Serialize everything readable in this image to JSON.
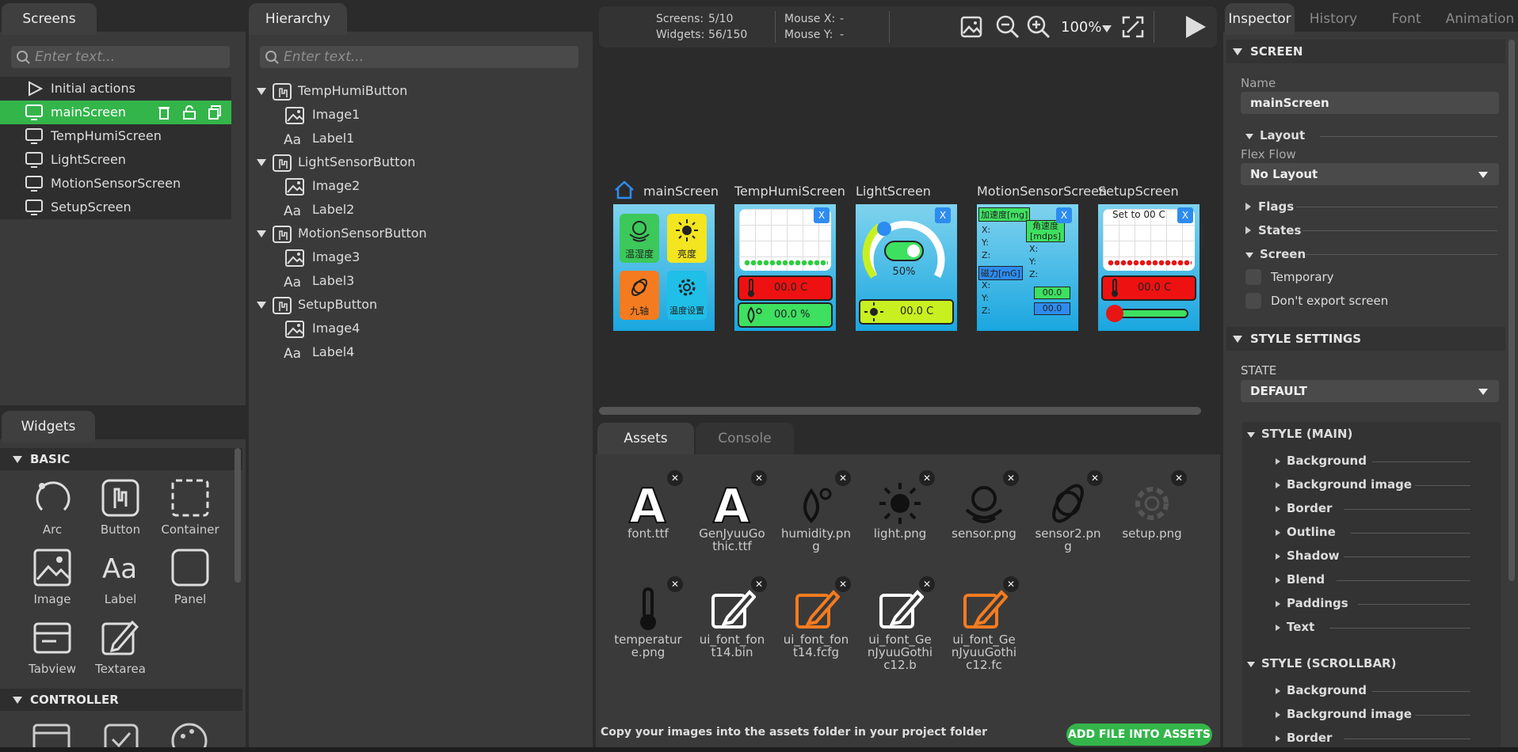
{
  "screens_panel": {
    "tab": "Screens",
    "search_placeholder": "Enter text...",
    "items": [
      {
        "label": "Initial actions"
      },
      {
        "label": "mainScreen"
      },
      {
        "label": "TempHumiScreen"
      },
      {
        "label": "LightScreen"
      },
      {
        "label": "MotionSensorScreen"
      },
      {
        "label": "SetupScreen"
      }
    ]
  },
  "hierarchy_panel": {
    "tab": "Hierarchy",
    "search_placeholder": "Enter text...",
    "items": [
      {
        "label": "TempHumiButton"
      },
      {
        "label": "Image1"
      },
      {
        "label": "Label1"
      },
      {
        "label": "LightSensorButton"
      },
      {
        "label": "Image2"
      },
      {
        "label": "Label2"
      },
      {
        "label": "MotionSensorButton"
      },
      {
        "label": "Image3"
      },
      {
        "label": "Label3"
      },
      {
        "label": "SetupButton"
      },
      {
        "label": "Image4"
      },
      {
        "label": "Label4"
      }
    ]
  },
  "widgets_panel": {
    "tab": "Widgets",
    "basic_header": "BASIC",
    "controller_header": "CONTROLLER",
    "basic": [
      {
        "label": "Arc",
        "icon": "arc-icon"
      },
      {
        "label": "Button",
        "icon": "button-icon"
      },
      {
        "label": "Container",
        "icon": "container-icon"
      },
      {
        "label": "Image",
        "icon": "image-icon"
      },
      {
        "label": "Label",
        "icon": "label-icon"
      },
      {
        "label": "Panel",
        "icon": "panel-icon"
      },
      {
        "label": "Tabview",
        "icon": "tabview-icon"
      },
      {
        "label": "Textarea",
        "icon": "textarea-icon"
      }
    ]
  },
  "toolbar": {
    "screens_label": "Screens:",
    "screens_value": "5/10",
    "widgets_label": "Widgets:",
    "widgets_value": "56/150",
    "mouse_x_label": "Mouse X:",
    "mouse_x_value": "-",
    "mouse_y_label": "Mouse Y:",
    "mouse_y_value": "-",
    "zoom": "100%"
  },
  "canvas": {
    "screens": [
      {
        "title": "mainScreen",
        "home": true
      },
      {
        "title": "TempHumiScreen"
      },
      {
        "title": "LightScreen"
      },
      {
        "title": "MotionSensorScreen"
      },
      {
        "title": "SetupScreen"
      }
    ],
    "main": {
      "btn1": "温湿度",
      "btn2": "亮度",
      "btn3": "九轴",
      "btn4": "温度设置"
    },
    "temphumi": {
      "temp": "00.0 C",
      "humi": "00.0 %"
    },
    "light": {
      "percent": "50%",
      "value": "00.0 C"
    },
    "motion": {
      "accel": "加速度[mg]",
      "gyro_line1": "角速度",
      "gyro_line2": "[mdps]",
      "mag": "磁力[mG]",
      "x": "X:",
      "y": "Y:",
      "z": "Z:",
      "val1": "00.0",
      "val2": "00.0"
    },
    "setup": {
      "title": "Set to 00 C",
      "temp": "00.0 C"
    },
    "close": "X"
  },
  "bottom_panel": {
    "tab_assets": "Assets",
    "tab_console": "Console",
    "assets": [
      {
        "name": "font.ttf",
        "icon": "font-icon"
      },
      {
        "name": "GenJyuuGothic.ttf",
        "icon": "font-icon"
      },
      {
        "name": "humidity.png",
        "icon": "humidity-icon"
      },
      {
        "name": "light.png",
        "icon": "sun-icon"
      },
      {
        "name": "sensor.png",
        "icon": "sensor-icon"
      },
      {
        "name": "sensor2.png",
        "icon": "orbit-icon"
      },
      {
        "name": "setup.png",
        "icon": "gear-icon"
      },
      {
        "name": "temperature.png",
        "icon": "thermometer-icon"
      },
      {
        "name": "ui_font_font14.bin",
        "icon": "edit-icon"
      },
      {
        "name": "ui_font_font14.fcfg",
        "icon": "edit-icon"
      },
      {
        "name": "ui_font_GenJyuuGothic12.b",
        "icon": "edit-icon"
      },
      {
        "name": "ui_font_GenJyuuGothic12.fc",
        "icon": "edit-icon"
      }
    ],
    "hint": "Copy your images into the assets folder in your project folder",
    "add_button": "ADD FILE INTO ASSETS"
  },
  "inspector": {
    "tabs": [
      "Inspector",
      "History",
      "Font",
      "Animation"
    ],
    "screen_header": "SCREEN",
    "name_label": "Name",
    "name_value": "mainScreen",
    "layout_header": "Layout",
    "flex_flow_label": "Flex Flow",
    "flex_flow_value": "No Layout",
    "flags": "Flags",
    "states": "States",
    "screen_sub": "Screen",
    "temporary": "Temporary",
    "dont_export": "Don't export screen",
    "style_settings": "STYLE SETTINGS",
    "state_label": "STATE",
    "state_value": "DEFAULT",
    "style_main": "STYLE (MAIN)",
    "style_main_items": [
      "Background",
      "Background image",
      "Border",
      "Outline",
      "Shadow",
      "Blend",
      "Paddings",
      "Text"
    ],
    "style_scrollbar": "STYLE (SCROLLBAR)",
    "style_scrollbar_items": [
      "Background",
      "Background image",
      "Border"
    ]
  },
  "colors": {
    "accent_green": "#33b54a",
    "orange": "#f47b20",
    "cyan": "#1fbfe8"
  }
}
